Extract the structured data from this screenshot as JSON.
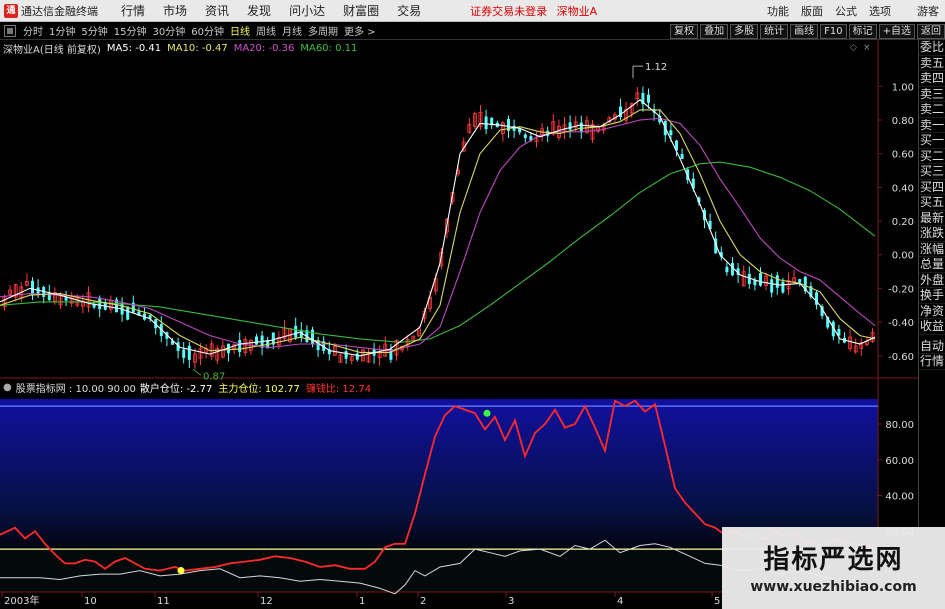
{
  "app": {
    "title": "通达信金融终端",
    "logo": "通"
  },
  "menu": [
    "行情",
    "市场",
    "资讯",
    "发现",
    "问小达",
    "财富圈",
    "交易"
  ],
  "notice": [
    "证券交易未登录",
    "深物业A"
  ],
  "right_menu": [
    "功能",
    "版面",
    "公式",
    "选项",
    "游客"
  ],
  "periods": [
    {
      "label": "分时",
      "active": false
    },
    {
      "label": "1分钟",
      "active": false
    },
    {
      "label": "5分钟",
      "active": false
    },
    {
      "label": "15分钟",
      "active": false
    },
    {
      "label": "30分钟",
      "active": false
    },
    {
      "label": "60分钟",
      "active": false
    },
    {
      "label": "日线",
      "active": true
    },
    {
      "label": "周线",
      "active": false
    },
    {
      "label": "月线",
      "active": false
    },
    {
      "label": "多周期",
      "active": false
    },
    {
      "label": "更多 >",
      "active": false
    }
  ],
  "right_tools": [
    "复权",
    "叠加",
    "多股",
    "统计",
    "画线",
    "F10",
    "标记",
    "+自选",
    "返回"
  ],
  "main_header": {
    "stock": "深物业A(日线 前复权)",
    "ma": [
      {
        "label": "MA5: -0.41",
        "color": "#ffffff"
      },
      {
        "label": "MA10: -0.47",
        "color": "#e8e86a"
      },
      {
        "label": "MA20: -0.36",
        "color": "#d050d0"
      },
      {
        "label": "MA60: 0.11",
        "color": "#40c040"
      }
    ]
  },
  "sub_header": {
    "indicator": "股票指标网 : 10.00  90.00",
    "items": [
      {
        "label": "散户仓位: -2.77",
        "color": "#ffffff"
      },
      {
        "label": "主力仓位: 102.77",
        "color": "#ffff55"
      },
      {
        "label": "镰钱比: 12.74",
        "color": "#ff3030"
      }
    ]
  },
  "sidebar": [
    "委比",
    "卖五",
    "卖四",
    "卖三",
    "卖二",
    "卖一",
    "买一",
    "买二",
    "买三",
    "买四",
    "买五",
    "最新",
    "涨跌",
    "涨幅",
    "总量",
    "外盘",
    "换手",
    "净资",
    "收益"
  ],
  "sidebar2": [
    "自动",
    "行情"
  ],
  "price_axis": [
    "1.00",
    "0.80",
    "0.60",
    "0.40",
    "0.20",
    "0.00",
    "-0.20",
    "-0.40",
    "-0.60"
  ],
  "ind_axis": [
    "80.00",
    "60.00",
    "40.00",
    "20.00"
  ],
  "date_axis": [
    "2003年",
    "10",
    "11",
    "12",
    "1",
    "2",
    "3",
    "4",
    "5"
  ],
  "annotations": {
    "high": "1.12",
    "low": "0.87"
  },
  "colors": {
    "up": "#ff3b3b",
    "down": "#54ffff",
    "grid": "#7a1a1a"
  },
  "watermark": {
    "title": "指标严选网",
    "url": "www.xuezhibiao.com"
  },
  "chart_data": {
    "type": "candlestick",
    "ylim": [
      -0.72,
      1.18
    ],
    "ind_ylim": [
      -14,
      94
    ],
    "kline_points": [
      [
        0,
        -0.27
      ],
      [
        15,
        -0.22
      ],
      [
        30,
        -0.18
      ],
      [
        45,
        -0.22
      ],
      [
        60,
        -0.25
      ],
      [
        75,
        -0.27
      ],
      [
        90,
        -0.29
      ],
      [
        105,
        -0.31
      ],
      [
        120,
        -0.33
      ],
      [
        135,
        -0.33
      ],
      [
        150,
        -0.38
      ],
      [
        165,
        -0.47
      ],
      [
        180,
        -0.56
      ],
      [
        195,
        -0.62
      ],
      [
        210,
        -0.58
      ],
      [
        225,
        -0.55
      ],
      [
        240,
        -0.53
      ],
      [
        255,
        -0.51
      ],
      [
        270,
        -0.52
      ],
      [
        285,
        -0.48
      ],
      [
        300,
        -0.45
      ],
      [
        315,
        -0.51
      ],
      [
        330,
        -0.58
      ],
      [
        345,
        -0.62
      ],
      [
        360,
        -0.6
      ],
      [
        375,
        -0.57
      ],
      [
        390,
        -0.57
      ],
      [
        405,
        -0.53
      ],
      [
        415,
        -0.47
      ],
      [
        425,
        -0.35
      ],
      [
        435,
        -0.15
      ],
      [
        445,
        0.15
      ],
      [
        455,
        0.45
      ],
      [
        465,
        0.72
      ],
      [
        475,
        0.79
      ],
      [
        485,
        0.8
      ],
      [
        495,
        0.77
      ],
      [
        505,
        0.76
      ],
      [
        515,
        0.78
      ],
      [
        525,
        0.72
      ],
      [
        535,
        0.68
      ],
      [
        545,
        0.73
      ],
      [
        555,
        0.73
      ],
      [
        565,
        0.77
      ],
      [
        575,
        0.78
      ],
      [
        585,
        0.75
      ],
      [
        595,
        0.75
      ],
      [
        605,
        0.78
      ],
      [
        615,
        0.82
      ],
      [
        625,
        0.85
      ],
      [
        635,
        0.93
      ],
      [
        645,
        0.92
      ],
      [
        655,
        0.86
      ],
      [
        665,
        0.76
      ],
      [
        675,
        0.64
      ],
      [
        685,
        0.51
      ],
      [
        695,
        0.38
      ],
      [
        705,
        0.23
      ],
      [
        715,
        0.06
      ],
      [
        725,
        -0.07
      ],
      [
        735,
        -0.12
      ],
      [
        745,
        -0.13
      ],
      [
        755,
        -0.15
      ],
      [
        765,
        -0.17
      ],
      [
        775,
        -0.18
      ],
      [
        785,
        -0.18
      ],
      [
        795,
        -0.16
      ],
      [
        805,
        -0.19
      ],
      [
        815,
        -0.26
      ],
      [
        825,
        -0.37
      ],
      [
        835,
        -0.47
      ],
      [
        845,
        -0.53
      ],
      [
        855,
        -0.54
      ],
      [
        865,
        -0.52
      ],
      [
        875,
        -0.48
      ]
    ],
    "ma5": [
      [
        0,
        -0.28
      ],
      [
        30,
        -0.2
      ],
      [
        60,
        -0.24
      ],
      [
        90,
        -0.29
      ],
      [
        120,
        -0.32
      ],
      [
        150,
        -0.38
      ],
      [
        180,
        -0.55
      ],
      [
        210,
        -0.59
      ],
      [
        240,
        -0.53
      ],
      [
        270,
        -0.51
      ],
      [
        300,
        -0.46
      ],
      [
        330,
        -0.57
      ],
      [
        360,
        -0.6
      ],
      [
        390,
        -0.56
      ],
      [
        420,
        -0.43
      ],
      [
        440,
        -0.05
      ],
      [
        460,
        0.6
      ],
      [
        480,
        0.78
      ],
      [
        500,
        0.77
      ],
      [
        520,
        0.75
      ],
      [
        540,
        0.7
      ],
      [
        560,
        0.74
      ],
      [
        580,
        0.77
      ],
      [
        600,
        0.76
      ],
      [
        620,
        0.83
      ],
      [
        640,
        0.92
      ],
      [
        660,
        0.82
      ],
      [
        680,
        0.57
      ],
      [
        700,
        0.3
      ],
      [
        720,
        0.0
      ],
      [
        740,
        -0.12
      ],
      [
        760,
        -0.16
      ],
      [
        780,
        -0.18
      ],
      [
        800,
        -0.17
      ],
      [
        820,
        -0.3
      ],
      [
        840,
        -0.5
      ],
      [
        860,
        -0.53
      ],
      [
        875,
        -0.49
      ]
    ],
    "ma10": [
      [
        0,
        -0.3
      ],
      [
        30,
        -0.24
      ],
      [
        60,
        -0.23
      ],
      [
        90,
        -0.27
      ],
      [
        120,
        -0.3
      ],
      [
        150,
        -0.35
      ],
      [
        180,
        -0.48
      ],
      [
        210,
        -0.57
      ],
      [
        240,
        -0.56
      ],
      [
        270,
        -0.53
      ],
      [
        300,
        -0.49
      ],
      [
        330,
        -0.53
      ],
      [
        360,
        -0.58
      ],
      [
        390,
        -0.58
      ],
      [
        420,
        -0.5
      ],
      [
        440,
        -0.3
      ],
      [
        460,
        0.25
      ],
      [
        480,
        0.6
      ],
      [
        500,
        0.74
      ],
      [
        520,
        0.76
      ],
      [
        540,
        0.73
      ],
      [
        560,
        0.72
      ],
      [
        580,
        0.75
      ],
      [
        600,
        0.76
      ],
      [
        620,
        0.79
      ],
      [
        640,
        0.86
      ],
      [
        660,
        0.86
      ],
      [
        680,
        0.72
      ],
      [
        700,
        0.48
      ],
      [
        720,
        0.2
      ],
      [
        740,
        0.0
      ],
      [
        760,
        -0.1
      ],
      [
        780,
        -0.15
      ],
      [
        800,
        -0.17
      ],
      [
        820,
        -0.22
      ],
      [
        840,
        -0.38
      ],
      [
        860,
        -0.48
      ],
      [
        875,
        -0.5
      ]
    ],
    "ma20": [
      [
        0,
        -0.25
      ],
      [
        30,
        -0.23
      ],
      [
        60,
        -0.24
      ],
      [
        90,
        -0.25
      ],
      [
        120,
        -0.28
      ],
      [
        150,
        -0.32
      ],
      [
        180,
        -0.4
      ],
      [
        210,
        -0.48
      ],
      [
        240,
        -0.53
      ],
      [
        270,
        -0.55
      ],
      [
        300,
        -0.53
      ],
      [
        330,
        -0.53
      ],
      [
        360,
        -0.55
      ],
      [
        390,
        -0.57
      ],
      [
        420,
        -0.53
      ],
      [
        440,
        -0.43
      ],
      [
        460,
        -0.1
      ],
      [
        480,
        0.25
      ],
      [
        500,
        0.5
      ],
      [
        520,
        0.64
      ],
      [
        540,
        0.71
      ],
      [
        560,
        0.73
      ],
      [
        580,
        0.73
      ],
      [
        600,
        0.74
      ],
      [
        620,
        0.77
      ],
      [
        640,
        0.8
      ],
      [
        660,
        0.81
      ],
      [
        680,
        0.78
      ],
      [
        700,
        0.65
      ],
      [
        720,
        0.45
      ],
      [
        740,
        0.28
      ],
      [
        760,
        0.1
      ],
      [
        780,
        -0.02
      ],
      [
        800,
        -0.1
      ],
      [
        820,
        -0.15
      ],
      [
        840,
        -0.25
      ],
      [
        860,
        -0.35
      ],
      [
        875,
        -0.42
      ]
    ],
    "ma60": [
      [
        0,
        -0.3
      ],
      [
        40,
        -0.28
      ],
      [
        80,
        -0.28
      ],
      [
        120,
        -0.29
      ],
      [
        160,
        -0.31
      ],
      [
        200,
        -0.35
      ],
      [
        240,
        -0.39
      ],
      [
        280,
        -0.43
      ],
      [
        320,
        -0.47
      ],
      [
        360,
        -0.5
      ],
      [
        400,
        -0.52
      ],
      [
        430,
        -0.5
      ],
      [
        460,
        -0.42
      ],
      [
        490,
        -0.3
      ],
      [
        520,
        -0.17
      ],
      [
        550,
        -0.04
      ],
      [
        580,
        0.1
      ],
      [
        610,
        0.23
      ],
      [
        640,
        0.37
      ],
      [
        670,
        0.48
      ],
      [
        700,
        0.54
      ],
      [
        720,
        0.55
      ],
      [
        750,
        0.52
      ],
      [
        780,
        0.46
      ],
      [
        810,
        0.38
      ],
      [
        840,
        0.27
      ],
      [
        875,
        0.11
      ]
    ],
    "retail": [
      [
        0,
        18
      ],
      [
        15,
        22
      ],
      [
        25,
        16
      ],
      [
        35,
        20
      ],
      [
        45,
        13
      ],
      [
        55,
        7
      ],
      [
        65,
        2
      ],
      [
        75,
        2
      ],
      [
        85,
        4
      ],
      [
        95,
        3
      ],
      [
        105,
        -1
      ],
      [
        115,
        3
      ],
      [
        125,
        5
      ],
      [
        135,
        2
      ],
      [
        145,
        -1
      ],
      [
        160,
        -2
      ],
      [
        175,
        0
      ],
      [
        185,
        -2
      ],
      [
        200,
        -1
      ],
      [
        215,
        0
      ],
      [
        230,
        2
      ],
      [
        245,
        3
      ],
      [
        260,
        4
      ],
      [
        275,
        6
      ],
      [
        290,
        5
      ],
      [
        305,
        3
      ],
      [
        320,
        0
      ],
      [
        335,
        1
      ],
      [
        350,
        -1
      ],
      [
        365,
        -1
      ],
      [
        375,
        3
      ],
      [
        385,
        11
      ],
      [
        395,
        13
      ],
      [
        405,
        13
      ],
      [
        415,
        30
      ],
      [
        425,
        52
      ],
      [
        435,
        73
      ],
      [
        445,
        85
      ],
      [
        455,
        90
      ],
      [
        465,
        88
      ],
      [
        475,
        86
      ],
      [
        485,
        77
      ],
      [
        495,
        84
      ],
      [
        505,
        71
      ],
      [
        515,
        82
      ],
      [
        525,
        62
      ],
      [
        535,
        75
      ],
      [
        545,
        80
      ],
      [
        555,
        88
      ],
      [
        565,
        78
      ],
      [
        575,
        80
      ],
      [
        585,
        90
      ],
      [
        595,
        78
      ],
      [
        605,
        65
      ],
      [
        615,
        93
      ],
      [
        625,
        90
      ],
      [
        635,
        93
      ],
      [
        645,
        87
      ],
      [
        655,
        91
      ],
      [
        665,
        68
      ],
      [
        675,
        44
      ],
      [
        685,
        36
      ],
      [
        695,
        30
      ],
      [
        705,
        24
      ],
      [
        715,
        22
      ],
      [
        725,
        18
      ],
      [
        735,
        20
      ],
      [
        745,
        17
      ],
      [
        755,
        18
      ],
      [
        765,
        15
      ],
      [
        775,
        20
      ],
      [
        785,
        17
      ],
      [
        795,
        19
      ],
      [
        805,
        15
      ],
      [
        815,
        13
      ],
      [
        825,
        12
      ],
      [
        835,
        16
      ],
      [
        845,
        14
      ],
      [
        855,
        13
      ],
      [
        865,
        12
      ],
      [
        875,
        12
      ]
    ],
    "main": [
      [
        0,
        -6
      ],
      [
        20,
        -6
      ],
      [
        40,
        -6
      ],
      [
        60,
        -7
      ],
      [
        80,
        -5
      ],
      [
        100,
        -4
      ],
      [
        120,
        -4
      ],
      [
        140,
        -2
      ],
      [
        160,
        -5
      ],
      [
        180,
        -4
      ],
      [
        200,
        -2
      ],
      [
        220,
        -1
      ],
      [
        240,
        -6
      ],
      [
        260,
        -5
      ],
      [
        280,
        -6
      ],
      [
        300,
        -8
      ],
      [
        320,
        -7
      ],
      [
        340,
        -8
      ],
      [
        360,
        -9
      ],
      [
        380,
        -12
      ],
      [
        395,
        -15
      ],
      [
        405,
        -10
      ],
      [
        415,
        -2
      ],
      [
        425,
        -5
      ],
      [
        440,
        0
      ],
      [
        460,
        2
      ],
      [
        475,
        10
      ],
      [
        490,
        8
      ],
      [
        505,
        6
      ],
      [
        520,
        9
      ],
      [
        540,
        10
      ],
      [
        560,
        6
      ],
      [
        575,
        12
      ],
      [
        590,
        10
      ],
      [
        605,
        15
      ],
      [
        620,
        8
      ],
      [
        640,
        12
      ],
      [
        655,
        13
      ],
      [
        670,
        11
      ],
      [
        690,
        6
      ],
      [
        705,
        2
      ],
      [
        720,
        1
      ],
      [
        740,
        -2
      ],
      [
        760,
        -1
      ],
      [
        780,
        -4
      ],
      [
        800,
        -2
      ],
      [
        820,
        -5
      ],
      [
        840,
        -7
      ],
      [
        860,
        -10
      ],
      [
        875,
        -12
      ]
    ],
    "ind_markers": [
      {
        "x": 487,
        "y": 86,
        "color": "#40ff40"
      },
      {
        "x": 181,
        "y": -2,
        "color": "#ffff40"
      }
    ],
    "ind_levels": [
      90,
      10
    ]
  }
}
